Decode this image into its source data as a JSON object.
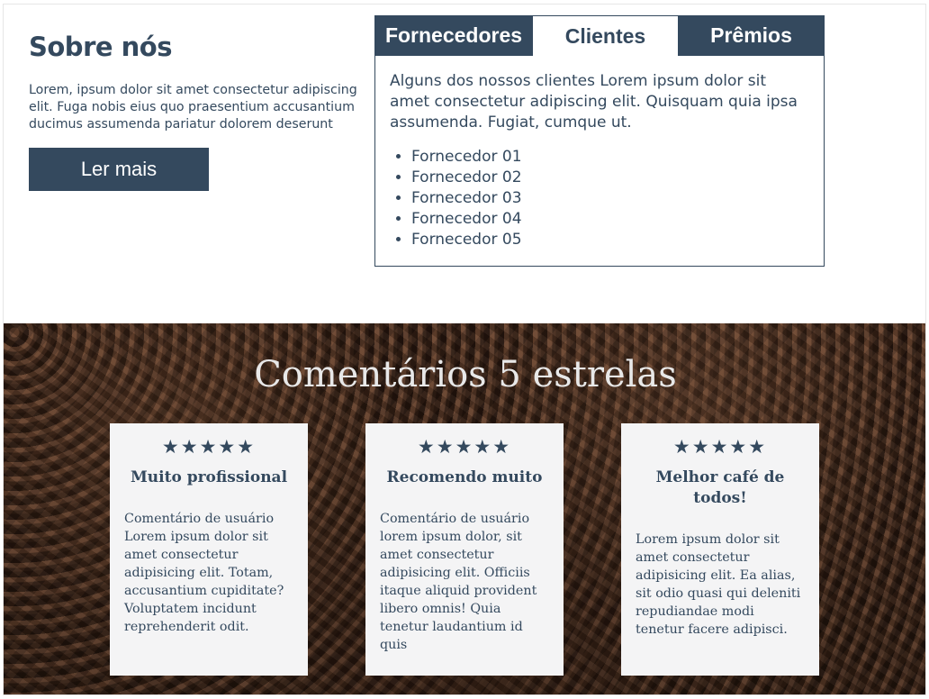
{
  "about": {
    "title": "Sobre nós",
    "text": "Lorem, ipsum dolor sit amet consectetur adipiscing elit. Fuga nobis eius quo praesentium accusantium ducimus assumenda pariatur dolorem deserunt",
    "button_label": "Ler mais"
  },
  "tabs": {
    "items": [
      {
        "label": "Fornecedores",
        "active": false
      },
      {
        "label": "Clientes",
        "active": true
      },
      {
        "label": "Prêmios",
        "active": false
      }
    ],
    "panel": {
      "intro": "Alguns dos nossos clientes Lorem ipsum dolor sit amet consectetur adipiscing elit. Quisquam quia ipsa assumenda. Fugiat, cumque ut.",
      "list": [
        "Fornecedor 01",
        "Fornecedor 02",
        "Fornecedor 03",
        "Fornecedor 04",
        "Fornecedor 05"
      ]
    }
  },
  "reviews": {
    "title": "Comentários 5 estrelas",
    "cards": [
      {
        "stars": "★★★★★",
        "rating": 5,
        "heading": "Muito profissional",
        "comment": "Comentário de usuário Lorem ipsum dolor sit amet consectetur adipisicing elit. Totam, accusantium cupiditate? Voluptatem incidunt reprehenderit odit."
      },
      {
        "stars": "★★★★★",
        "rating": 5,
        "heading": "Recomendo muito",
        "comment": "Comentário de usuário lorem ipsum dolor, sit amet consectetur adipisicing elit. Officiis itaque aliquid provident libero omnis! Quia tenetur laudantium id quis"
      },
      {
        "stars": "★★★★★",
        "rating": 5,
        "heading": "Melhor café de todos!",
        "comment": "Lorem ipsum dolor sit amet consectetur adipisicing elit. Ea alias, sit odio quasi qui deleniti repudiandae modi tenetur facere adipisci."
      }
    ]
  },
  "colors": {
    "primary": "#34495e",
    "card_bg": "#f4f4f5",
    "reviews_title": "#e8e8e8"
  }
}
